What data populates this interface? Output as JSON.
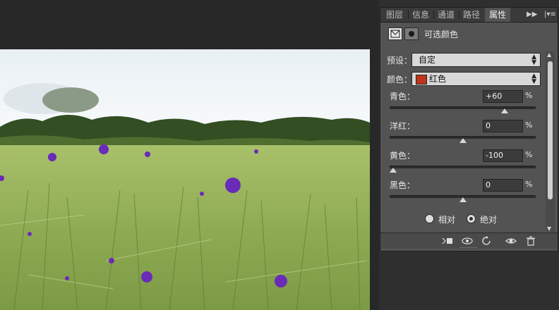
{
  "tabs": [
    {
      "label": "图层",
      "active": false
    },
    {
      "label": "信息",
      "active": false
    },
    {
      "label": "通道",
      "active": false
    },
    {
      "label": "路径",
      "active": false
    },
    {
      "label": "属性",
      "active": true
    }
  ],
  "panel": {
    "title": "可选颜色",
    "preset": {
      "label": "预设：",
      "value": "自定"
    },
    "colors": {
      "label": "颜色：",
      "value": "红色",
      "swatch": "#c0341c"
    },
    "sliders": [
      {
        "label": "青色：",
        "value": "+60",
        "unit": "%",
        "level": 0.8
      },
      {
        "label": "洋红：",
        "value": "0",
        "unit": "%",
        "level": 0.5
      },
      {
        "label": "黄色：",
        "value": "-100",
        "unit": "%",
        "level": 0.0
      },
      {
        "label": "黑色：",
        "value": "0",
        "unit": "%",
        "level": 0.5
      }
    ],
    "method": {
      "relative": "相对",
      "absolute": "绝对",
      "selected": "absolute"
    }
  },
  "bottom_icons": [
    "clip-to-layer-icon",
    "view-previous-icon",
    "reset-icon",
    "visibility-eye-icon",
    "trash-icon"
  ],
  "canvas_colors": {
    "sky": "#f2f6f8",
    "trees": "#2f4a1e",
    "field": "#93b25a",
    "flowers": "#6a2bb8"
  }
}
